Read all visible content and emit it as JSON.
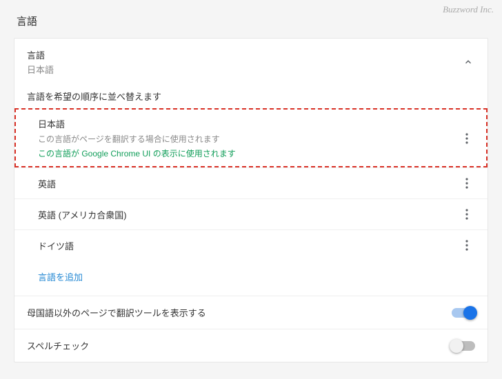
{
  "watermark": "Buzzword Inc.",
  "page_title": "言語",
  "card": {
    "title": "言語",
    "subtitle": "日本語",
    "sort_instruction": "言語を希望の順序に並べ替えます"
  },
  "languages": [
    {
      "name": "日本語",
      "desc": "この言語がページを翻訳する場合に使用されます",
      "active_note": "この言語が Google Chrome UI の表示に使用されます",
      "highlighted": true
    },
    {
      "name": "英語"
    },
    {
      "name": "英語 (アメリカ合衆国)"
    },
    {
      "name": "ドイツ語"
    }
  ],
  "add_language_label": "言語を追加",
  "options": {
    "translate_prompt": {
      "label": "母国語以外のページで翻訳ツールを表示する",
      "on": true
    },
    "spellcheck": {
      "label": "スペルチェック",
      "on": false
    }
  }
}
